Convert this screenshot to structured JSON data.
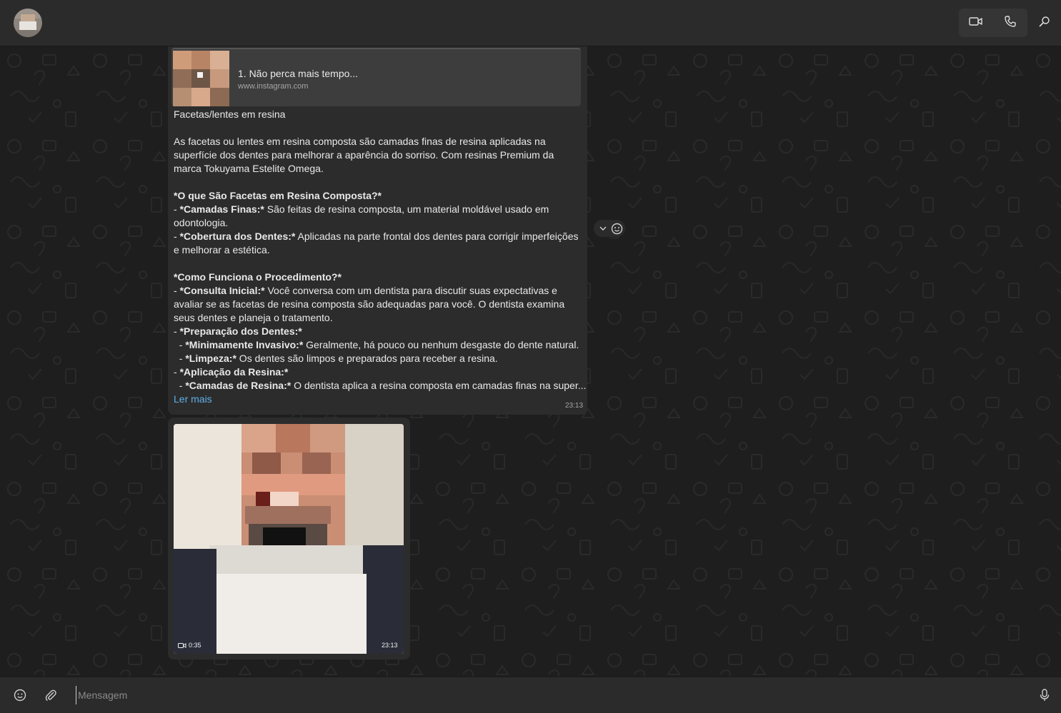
{
  "header": {
    "contact_name": "",
    "video_call_icon": "video-camera-icon",
    "voice_call_icon": "phone-icon",
    "search_icon": "search-icon"
  },
  "link_preview": {
    "title": "1. Não perca mais tempo...",
    "url": "www.instagram.com"
  },
  "message": {
    "lines": [
      [
        {
          "t": "Facetas/lentes em resina",
          "b": false
        }
      ],
      [],
      [
        {
          "t": "As facetas ou lentes em resina composta são camadas finas de resina aplicadas na",
          "b": false
        }
      ],
      [
        {
          "t": "superfície dos dentes para melhorar a aparência do sorriso. Com resinas Premium da",
          "b": false
        }
      ],
      [
        {
          "t": "marca Tokuyama Estelite Omega.",
          "b": false
        }
      ],
      [],
      [
        {
          "t": "*O que São Facetas em Resina Composta?*",
          "b": true
        }
      ],
      [
        {
          "t": "- ",
          "b": false
        },
        {
          "t": "*Camadas Finas:*",
          "b": true
        },
        {
          "t": " São feitas de resina composta, um material moldável usado em",
          "b": false
        }
      ],
      [
        {
          "t": "odontologia.",
          "b": false
        }
      ],
      [
        {
          "t": "- ",
          "b": false
        },
        {
          "t": "*Cobertura dos Dentes:*",
          "b": true
        },
        {
          "t": " Aplicadas na parte frontal dos dentes para corrigir imperfeições",
          "b": false
        }
      ],
      [
        {
          "t": "e melhorar a estética.",
          "b": false
        }
      ],
      [],
      [
        {
          "t": "*Como Funciona o Procedimento?*",
          "b": true
        }
      ],
      [
        {
          "t": "- ",
          "b": false
        },
        {
          "t": "*Consulta Inicial:*",
          "b": true
        },
        {
          "t": " Você conversa com um dentista para discutir suas expectativas e",
          "b": false
        }
      ],
      [
        {
          "t": "avaliar se as facetas de resina composta são adequadas para você. O dentista examina",
          "b": false
        }
      ],
      [
        {
          "t": "seus dentes e planeja o tratamento.",
          "b": false
        }
      ],
      [
        {
          "t": "- ",
          "b": false
        },
        {
          "t": "*Preparação dos Dentes:*",
          "b": true
        }
      ],
      [
        {
          "t": "  - ",
          "b": false
        },
        {
          "t": "*Minimamente Invasivo:*",
          "b": true
        },
        {
          "t": " Geralmente, há pouco ou nenhum desgaste do dente natural.",
          "b": false
        }
      ],
      [
        {
          "t": "  - ",
          "b": false
        },
        {
          "t": "*Limpeza:*",
          "b": true
        },
        {
          "t": " Os dentes são limpos e preparados para receber a resina.",
          "b": false
        }
      ],
      [
        {
          "t": "- ",
          "b": false
        },
        {
          "t": "*Aplicação da Resina:*",
          "b": true
        }
      ],
      [
        {
          "t": "  - ",
          "b": false
        },
        {
          "t": "*Camadas de Resina:*",
          "b": true
        },
        {
          "t": " O dentista aplica a resina composta em camadas finas na super...",
          "b": false
        }
      ]
    ],
    "read_more": "Ler mais",
    "time": "23:13"
  },
  "reaction_bar": {
    "chevron_icon": "chevron-down-icon",
    "emoji_icon": "smiley-icon"
  },
  "video_message": {
    "duration": "0:35",
    "time": "23:13"
  },
  "composer": {
    "placeholder": "Mensagem",
    "emoji_icon": "smiley-icon",
    "attach_icon": "paperclip-icon",
    "mic_icon": "microphone-icon"
  },
  "colors": {
    "header_bg": "#2b2b2b",
    "chat_bg": "#1e1e1e",
    "bubble_bg": "#2c2c2c",
    "link_color": "#5fb0e8"
  }
}
